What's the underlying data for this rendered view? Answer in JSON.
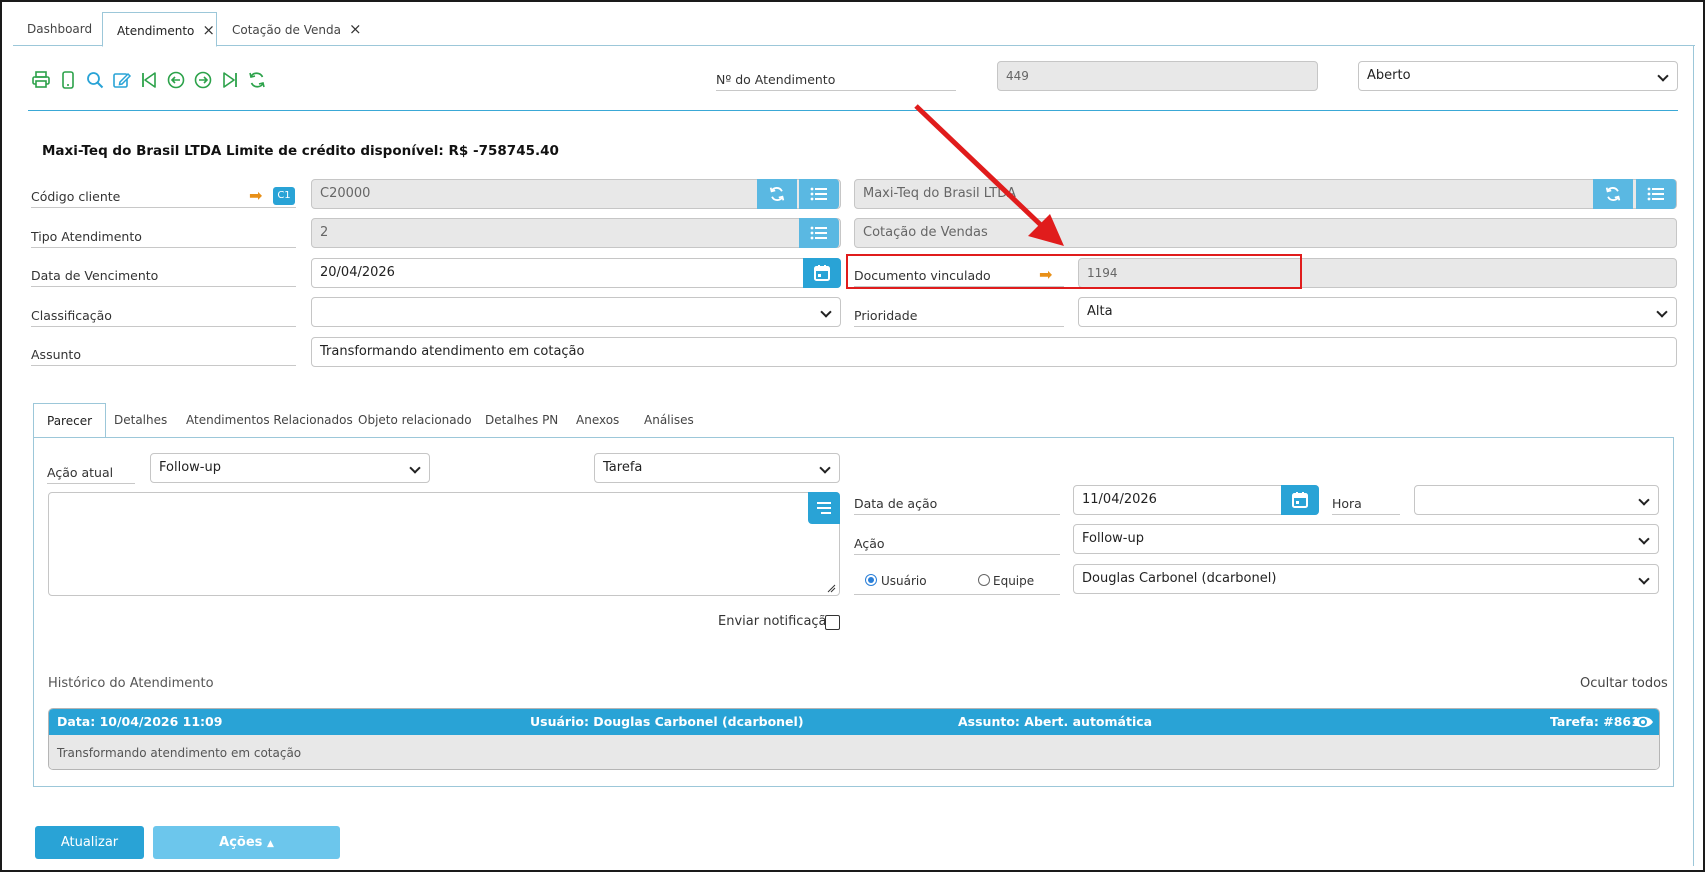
{
  "tabs": [
    {
      "label": "Dashboard"
    },
    {
      "label": "Atendimento"
    },
    {
      "label": "Cotação de Venda"
    }
  ],
  "toolbar": {
    "icons": [
      "print-icon",
      "mobile-icon",
      "search-icon",
      "edit-icon",
      "first-icon",
      "prev-icon",
      "next-icon",
      "last-icon",
      "refresh-icon"
    ]
  },
  "header": {
    "numero_label": "Nº do Atendimento",
    "numero_value": "449",
    "status_value": "Aberto"
  },
  "client_title": "Maxi-Teq do Brasil LTDA Limite de crédito disponível: R$ -758745.40",
  "form": {
    "codigo_cliente_label": "Código cliente",
    "c1_badge": "C1",
    "codigo_cliente_value": "C20000",
    "cliente_nome_value": "Maxi-Teq do Brasil LTDA",
    "tipo_atendimento_label": "Tipo Atendimento",
    "tipo_atendimento_value": "2",
    "tipo_atendimento_desc": "Cotação de Vendas",
    "data_vencimento_label": "Data de Vencimento",
    "data_vencimento_value": "20/04/2026",
    "documento_vinculado_label": "Documento vinculado",
    "documento_vinculado_value": "1194",
    "classificacao_label": "Classificação",
    "classificacao_value": "",
    "prioridade_label": "Prioridade",
    "prioridade_value": "Alta",
    "assunto_label": "Assunto",
    "assunto_value": "Transformando atendimento em cotação"
  },
  "inner_tabs": [
    {
      "label": "Parecer"
    },
    {
      "label": "Detalhes"
    },
    {
      "label": "Atendimentos Relacionados"
    },
    {
      "label": "Objeto relacionado"
    },
    {
      "label": "Detalhes PN"
    },
    {
      "label": "Anexos"
    },
    {
      "label": "Análises"
    }
  ],
  "parecer": {
    "acao_atual_label": "Ação atual",
    "acao_atual_value": "Follow-up",
    "tipo_value": "Tarefa",
    "data_acao_label": "Data de ação",
    "data_acao_value": "11/04/2026",
    "hora_label": "Hora",
    "hora_value": "",
    "acao_label": "Ação",
    "acao_value": "Follow-up",
    "radio_usuario": "Usuário",
    "radio_equipe": "Equipe",
    "responsavel_value": "Douglas Carbonel (dcarbonel)",
    "enviar_notificacao": "Enviar notificação"
  },
  "historico": {
    "title": "Histórico do Atendimento",
    "ocultar": "Ocultar todos",
    "data": "Data: 10/04/2026 11:09",
    "usuario": "Usuário: Douglas Carbonel (dcarbonel)",
    "assunto": "Assunto: Abert. automática",
    "tarefa": "Tarefa: #861",
    "body": "Transformando atendimento em cotação"
  },
  "buttons": {
    "atualizar": "Atualizar",
    "acoes": "Ações"
  },
  "colors": {
    "accent": "#29a3d6",
    "annotation": "#e01c1c",
    "orange": "#e89018"
  }
}
